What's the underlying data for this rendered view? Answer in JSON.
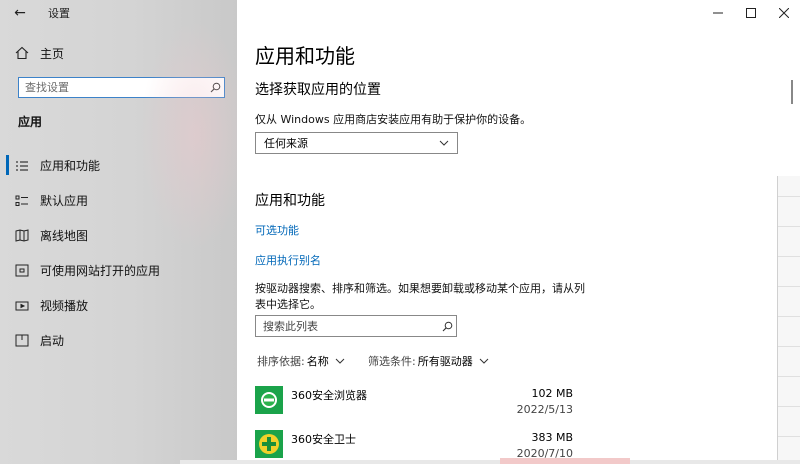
{
  "window": {
    "title": "设置",
    "controls": [
      "minimize",
      "maximize",
      "close"
    ]
  },
  "sidebar": {
    "home_label": "主页",
    "search_placeholder": "查找设置",
    "section": "应用",
    "items": [
      {
        "label": "应用和功能",
        "icon": "apps-list-icon",
        "active": true
      },
      {
        "label": "默认应用",
        "icon": "default-apps-icon",
        "active": false
      },
      {
        "label": "离线地图",
        "icon": "offline-map-icon",
        "active": false
      },
      {
        "label": "可使用网站打开的应用",
        "icon": "website-apps-icon",
        "active": false
      },
      {
        "label": "视频播放",
        "icon": "video-playback-icon",
        "active": false
      },
      {
        "label": "启动",
        "icon": "startup-icon",
        "active": false
      }
    ]
  },
  "main": {
    "title": "应用和功能",
    "install_source": {
      "heading": "选择获取应用的位置",
      "description": "仅从 Windows 应用商店安装应用有助于保护你的设备。",
      "selected": "任何来源"
    },
    "apps_section": {
      "heading": "应用和功能",
      "links": [
        "可选功能",
        "应用执行别名"
      ],
      "info": "按驱动器搜索、排序和筛选。如果想要卸载或移动某个应用，请从列表中选择它。",
      "search_placeholder": "搜索此列表",
      "sort_label": "排序依据:",
      "sort_value": "名称",
      "filter_label": "筛选条件:",
      "filter_value": "所有驱动器",
      "apps": [
        {
          "name": "360安全浏览器",
          "size": "102 MB",
          "date": "2022/5/13",
          "icon": "360-browser-icon",
          "color": "#1aa34a"
        },
        {
          "name": "360安全卫士",
          "size": "383 MB",
          "date": "2020/7/10",
          "icon": "360-safe-icon",
          "color": "#e8c21a"
        }
      ]
    }
  },
  "colors": {
    "accent": "#0067b8",
    "sidebar_bg": "#d6d6d6"
  }
}
